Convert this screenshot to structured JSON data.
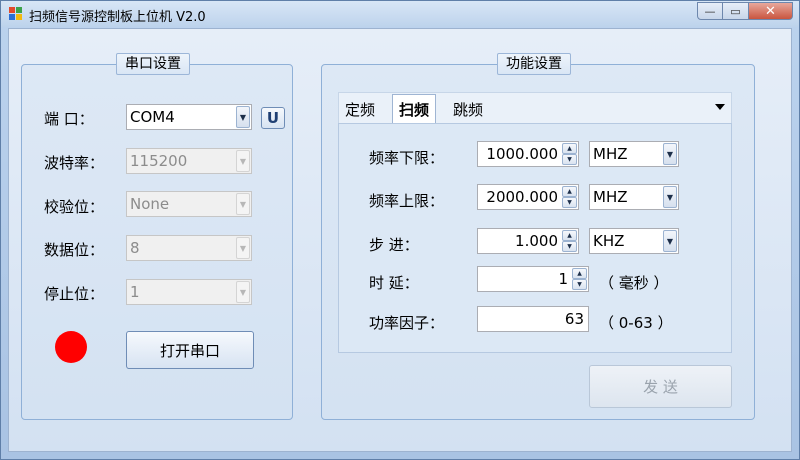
{
  "window": {
    "title": "扫频信号源控制板上位机 V2.0",
    "controls": {
      "minimize": "—",
      "maximize": "▭",
      "close": "✕"
    }
  },
  "serial": {
    "group_title": "串口设置",
    "port": {
      "label": "端  口：",
      "value": "COM4",
      "refresh_label": "U"
    },
    "baud": {
      "label": "波特率：",
      "value": "115200"
    },
    "parity": {
      "label": "校验位：",
      "value": "None"
    },
    "databits": {
      "label": "数据位：",
      "value": "8"
    },
    "stopbits": {
      "label": "停止位：",
      "value": "1"
    },
    "open_button": "打开串口",
    "status_color": "#ff0000"
  },
  "function": {
    "group_title": "功能设置",
    "tabs": [
      {
        "label": "定频",
        "active": false
      },
      {
        "label": "扫频",
        "active": true
      },
      {
        "label": "跳频",
        "active": false
      }
    ],
    "sweep": {
      "lower": {
        "label": "频率下限：",
        "value": "1000.000",
        "unit": "MHZ"
      },
      "upper": {
        "label": "频率上限：",
        "value": "2000.000",
        "unit": "MHZ"
      },
      "step": {
        "label": "步    进：",
        "value": "1.000",
        "unit": "KHZ"
      },
      "delay": {
        "label": "时    延：",
        "value": "1",
        "unit": "（ 毫秒 ）"
      },
      "power": {
        "label": "功率因子：",
        "value": "63",
        "range": "（ 0-63 ）"
      }
    },
    "send_button": "发  送"
  },
  "colors": {
    "accent": "#8fb0d7",
    "status": "#ff0000"
  }
}
